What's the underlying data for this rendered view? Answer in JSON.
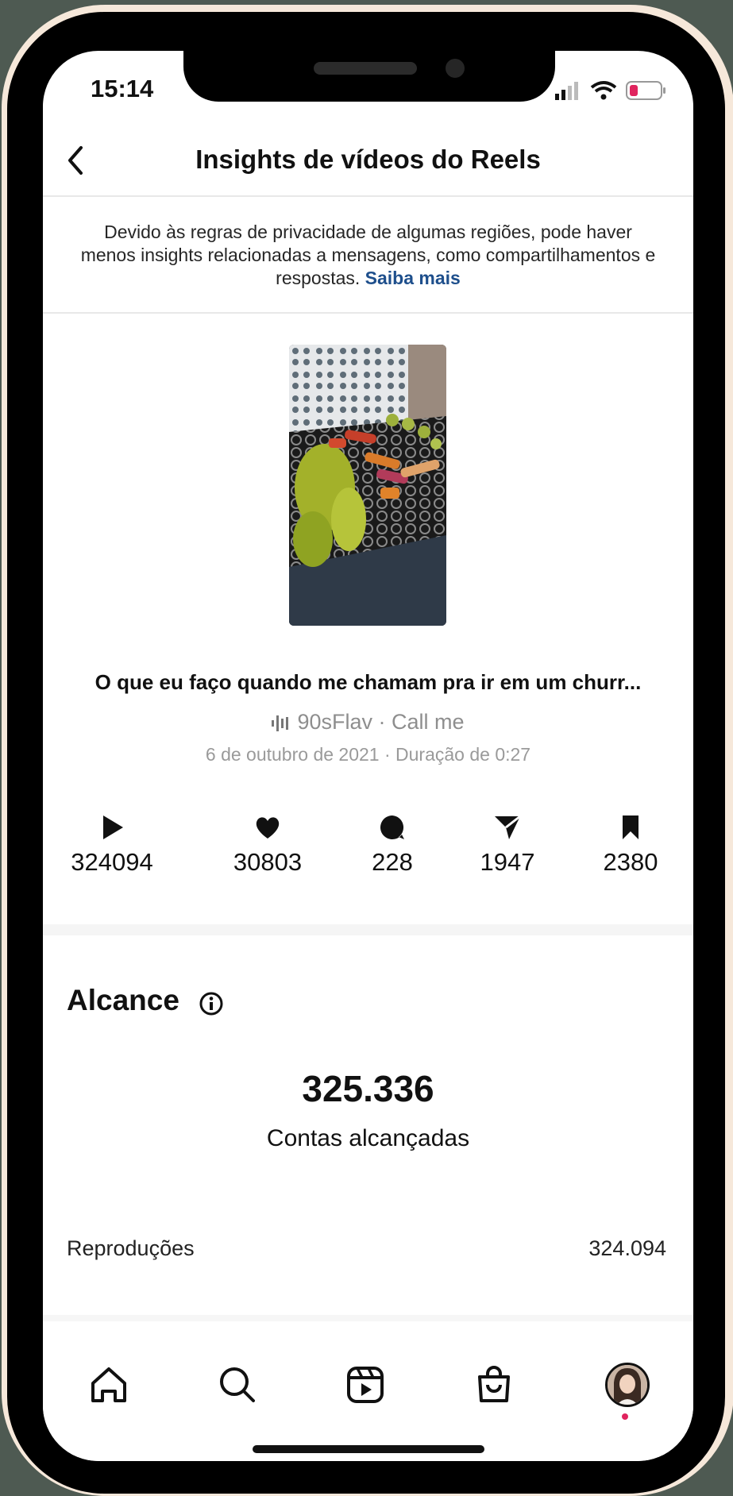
{
  "status_bar": {
    "time": "15:14"
  },
  "header": {
    "title": "Insights de vídeos do Reels",
    "back_icon": "chevron-left-icon"
  },
  "notice": {
    "text": "Devido às regras de privacidade de algumas regiões, pode haver menos insights relacionadas a mensagens, como compartilhamentos e respostas.",
    "link": "Saiba mais"
  },
  "reel": {
    "title": "O que eu faço quando me chamam pra ir em um churr...",
    "audio": "90sFlav · Call me",
    "meta": "6 de outubro de 2021 · Duração de 0:27"
  },
  "stats": [
    {
      "icon": "play-icon",
      "value": "324094"
    },
    {
      "icon": "heart-icon",
      "value": "30803"
    },
    {
      "icon": "comment-icon",
      "value": "228"
    },
    {
      "icon": "send-icon",
      "value": "1947"
    },
    {
      "icon": "bookmark-icon",
      "value": "2380"
    }
  ],
  "reach": {
    "title": "Alcance",
    "value": "325.336",
    "label": "Contas alcançadas",
    "rows": [
      {
        "label": "Reproduções",
        "value": "324.094"
      }
    ]
  },
  "nav": [
    "home-icon",
    "search-icon",
    "reels-icon",
    "shop-icon",
    "profile-avatar"
  ],
  "colors": {
    "link": "#1e4f8c",
    "muted": "#8e8e8e",
    "battery_low": "#e0245e"
  }
}
